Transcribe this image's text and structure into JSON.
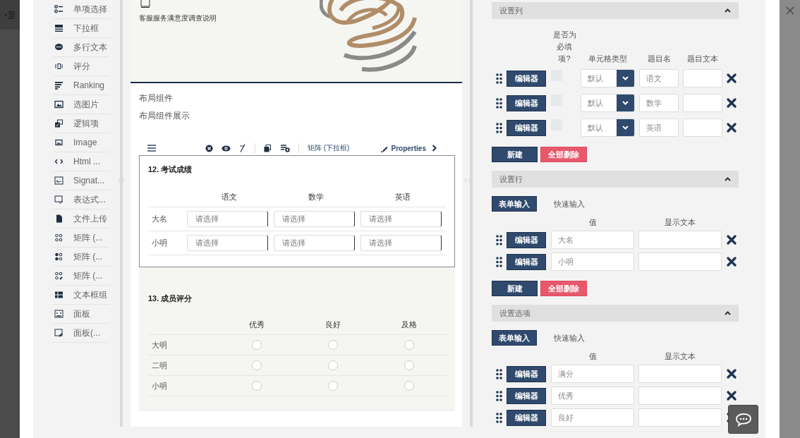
{
  "toolbox": {
    "items": [
      {
        "label": "单项选择"
      },
      {
        "label": "下拉框"
      },
      {
        "label": "多行文本"
      },
      {
        "label": "评分"
      },
      {
        "label": "Ranking"
      },
      {
        "label": "选图片"
      },
      {
        "label": "逻辑项"
      },
      {
        "label": "Image"
      },
      {
        "label": "Html ..."
      },
      {
        "label": "Signat..."
      },
      {
        "label": "表达式..."
      },
      {
        "label": "文件上传"
      },
      {
        "label": "矩阵 (..."
      },
      {
        "label": "矩阵 (..."
      },
      {
        "label": "矩阵 (..."
      },
      {
        "label": "文本框组"
      },
      {
        "label": "面板"
      },
      {
        "label": "面板(..."
      }
    ]
  },
  "survey_header": {
    "description": "客服服务满意度调查说明"
  },
  "page": {
    "title": "布局组件",
    "description": "布局组件展示"
  },
  "question_toolbar": {
    "type_label": "矩阵 (下拉框)",
    "properties_label": "Properties"
  },
  "questions": [
    {
      "kind": "dropdown_matrix",
      "title": "12. 考试成绩",
      "selected": true,
      "columns": [
        "语文",
        "数学",
        "英语"
      ],
      "rows": [
        {
          "label": "大名",
          "cells": [
            "请选择",
            "请选择",
            "请选择"
          ]
        },
        {
          "label": "小明",
          "cells": [
            "请选择",
            "请选择",
            "请选择"
          ]
        }
      ]
    },
    {
      "kind": "radio_matrix",
      "title": "13. 成员评分",
      "selected": false,
      "columns": [
        "优秀",
        "良好",
        "及格"
      ],
      "rows": [
        {
          "label": "大明",
          "checked": [
            false,
            false,
            false
          ]
        },
        {
          "label": "二明",
          "checked": [
            false,
            false,
            false
          ]
        },
        {
          "label": "小明",
          "checked": [
            false,
            false,
            false
          ]
        }
      ]
    }
  ],
  "properties": {
    "sections": [
      {
        "kind": "columns",
        "title": "设置列",
        "expanded": true,
        "headers": [
          "是否为必填项?",
          "单元格类型",
          "题目名",
          "题目文本"
        ],
        "rows": [
          {
            "edit_label": "编辑器",
            "required": false,
            "cell_type": "默认",
            "name": "语文"
          },
          {
            "edit_label": "编辑器",
            "required": false,
            "cell_type": "默认",
            "name": "数学"
          },
          {
            "edit_label": "编辑器",
            "required": false,
            "cell_type": "默认",
            "name": "英语"
          }
        ],
        "add_label": "新建",
        "delete_all_label": "全部删除"
      },
      {
        "kind": "items",
        "title": "设置行",
        "expanded": true,
        "tabs": [
          {
            "label": "表单输入",
            "selected": true
          },
          {
            "label": "快速输入",
            "selected": false
          }
        ],
        "headers": [
          "值",
          "显示文本"
        ],
        "rows": [
          {
            "edit_label": "编辑器",
            "value": "大名"
          },
          {
            "edit_label": "编辑器",
            "value": "小明"
          }
        ],
        "add_label": "新建",
        "delete_all_label": "全部删除"
      },
      {
        "kind": "items",
        "title": "设置选项",
        "expanded": true,
        "tabs": [
          {
            "label": "表单输入",
            "selected": true
          },
          {
            "label": "快速输入",
            "selected": false
          }
        ],
        "headers": [
          "值",
          "显示文本"
        ],
        "rows": [
          {
            "edit_label": "编辑器",
            "value": "满分"
          },
          {
            "edit_label": "编辑器",
            "value": "优秀"
          },
          {
            "edit_label": "编辑器",
            "value": "良好"
          }
        ]
      }
    ]
  }
}
